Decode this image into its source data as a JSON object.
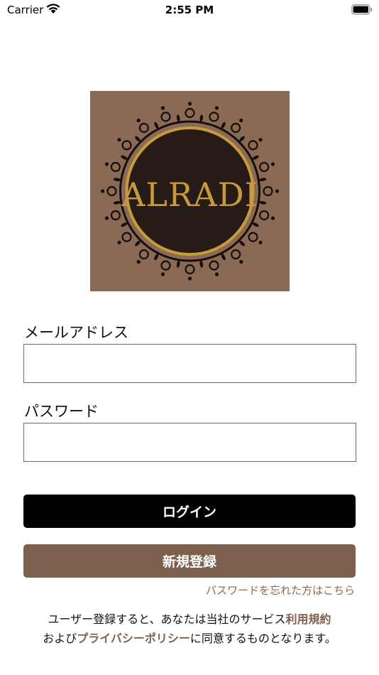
{
  "status_bar": {
    "carrier": "Carrier",
    "time": "2:55 PM"
  },
  "logo": {
    "text": "ALRADI",
    "icon": "alradi-logo",
    "colors": {
      "background": "#8a6a55",
      "circle": "#261b16",
      "ring": "#c79a3c",
      "ornament": "#150f0c"
    }
  },
  "form": {
    "email_label": "メールアドレス",
    "email_value": "",
    "password_label": "パスワード",
    "password_value": ""
  },
  "buttons": {
    "login_label": "ログイン",
    "register_label": "新規登録"
  },
  "forgot_password": "パスワードを忘れた方はこちら",
  "terms": {
    "line1_prefix": "ユーザー登録すると、あなたは当社のサービス",
    "terms_link": "利用規約",
    "line2_prefix": "および",
    "privacy_link": "プライバシーポリシー",
    "line2_suffix": "に同意するものとなります。"
  },
  "colors": {
    "accent_brown": "#7d5f4d",
    "login_black": "#000000"
  }
}
